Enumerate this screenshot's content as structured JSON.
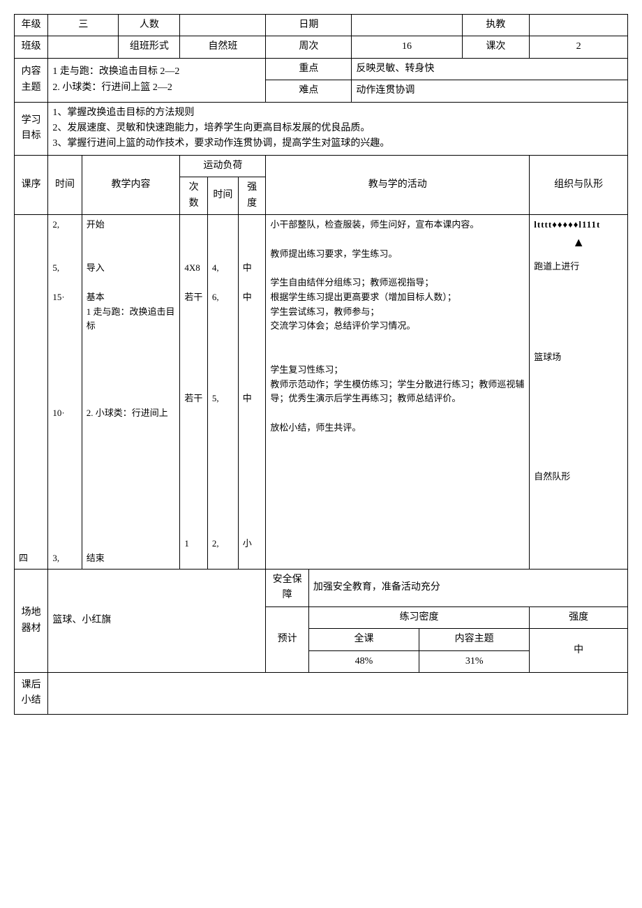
{
  "header": {
    "grade_label": "年级",
    "grade_value": "三",
    "people_label": "人数",
    "people_value": "",
    "date_label": "日期",
    "date_value": "",
    "teacher_label": "执教",
    "teacher_value": "",
    "class_label": "班级",
    "class_value": "",
    "classform_label": "组班形式",
    "classform_value": "自然班",
    "week_label": "周次",
    "week_value": "16",
    "session_label": "课次",
    "session_value": "2"
  },
  "content_theme": {
    "label": "内容主题",
    "text": "1 走与跑：改换追击目标 2—2\n2. 小球类：行进间上篮 2—2",
    "key_label": "重点",
    "key_text": "反映灵敏、转身快",
    "diff_label": "难点",
    "diff_text": "动作连贯协调"
  },
  "goals": {
    "label": "学习目标",
    "text": "1、掌握改换追击目标的方法规则\n2、发展速度、灵敏和快速跑能力，培养学生向更高目标发展的优良品质。\n3、掌握行进间上篮的动作技术，要求动作连贯协调，提高学生对篮球的兴趣。"
  },
  "columns": {
    "seq": "课序",
    "time": "时间",
    "content": "教学内容",
    "load": "运动负荷",
    "reps": "次数",
    "dur": "时间",
    "intensity": "强度",
    "activity": "教与学的活动",
    "formation": "组织与队形"
  },
  "body": {
    "seq": "四",
    "times": "2,\n\n\n5,\n\n15·\n\n\n\n\n\n\n\n10·\n\n\n\n\n\n\n\n\n\n3,",
    "content": "开始\n\n\n导入\n\n基本\n1 走与跑：改换追击目标\n\n\n\n\n\n2. 小球类：行进间上\n\n\n\n\n\n\n\n\n\n结束",
    "reps": "\n\n\n4X8\n\n若干\n\n\n\n\n\n\n若干\n\n\n\n\n\n\n\n\n\n1",
    "dur": "\n\n\n4,\n\n6,\n\n\n\n\n\n\n5,\n\n\n\n\n\n\n\n\n\n2,",
    "intensity": "\n\n\n中\n\n中\n\n\n\n\n\n\n中\n\n\n\n\n\n\n\n\n\n小",
    "activity": "小干部整队，检查服装，师生问好，宣布本课内容。\n\n教师提出练习要求，学生练习。\n\n学生自由结伴分组练习；教师巡视指导；\n根据学生练习提出更高要求（增加目标人数）；\n学生尝试练习，教师参与；\n交流学习体会；总结评价学习情况。\n\n\n学生复习性练习；\n教师示范动作；学生模仿练习；学生分散进行练习；教师巡视辅导；优秀生演示后学生再练习；教师总结评价。\n\n放松小结，师生共评。",
    "formation_symbol": "ltttt♦♦♦♦♦l111t",
    "formation_triangle": "▲",
    "formation_text1": "跑道上进行",
    "formation_text2": "篮球场",
    "formation_text3": "自然队形"
  },
  "footer": {
    "venue_label": "场地器材",
    "venue_text": "篮球、小红旗",
    "safety_label": "安全保障",
    "safety_text": "加强安全教育，准备活动充分",
    "estimate_label": "预计",
    "density_label": "练习密度",
    "intensity_label": "强度",
    "full_label": "全课",
    "full_value": "48%",
    "theme_label": "内容主题",
    "theme_value": "31%",
    "intensity_value": "中",
    "summary_label": "课后小结",
    "summary_text": ""
  }
}
